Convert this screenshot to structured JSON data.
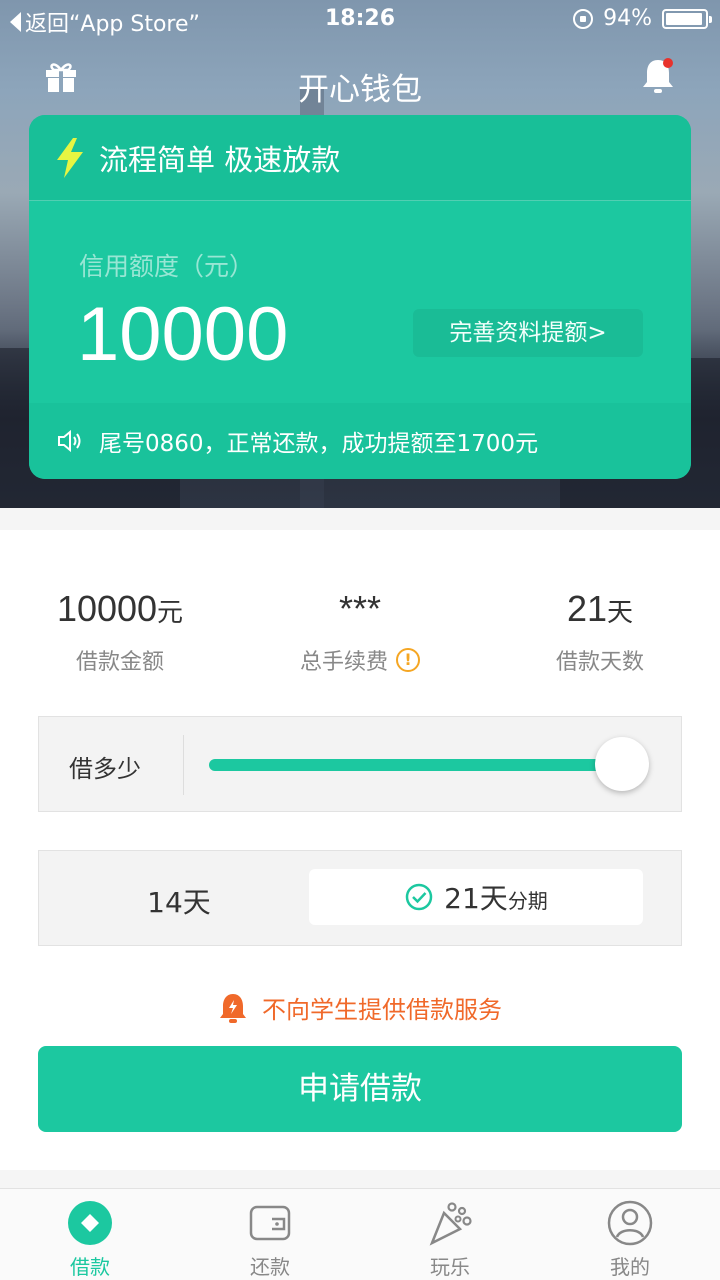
{
  "status_bar": {
    "back_label": "返回“App Store”",
    "time": "18:26",
    "battery": "94%",
    "battery_level": 0.94
  },
  "nav": {
    "title": "开心钱包",
    "left_icon": "gift-icon",
    "right_icon": "bell-icon",
    "has_unread": true
  },
  "card": {
    "headline": "流程简单 极速放款",
    "limit_label": "信用额度（元）",
    "limit_value": "10000",
    "improve_button": "完善资料提额>",
    "notice": "尾号0860，正常还款，成功提额至1700元"
  },
  "loan": {
    "amount_value": "10000",
    "amount_unit": "元",
    "amount_label": "借款金额",
    "fee_value": "***",
    "fee_label": "总手续费",
    "days_value": "21",
    "days_unit": "天",
    "days_label": "借款天数",
    "slider_label": "借多少",
    "slider_level": 1.0,
    "term_option_1": "14天",
    "term_option_2_main": "21天",
    "term_option_2_sub": "分期",
    "selected_term": "21天分期",
    "student_notice": "不向学生提供借款服务",
    "apply_button": "申请借款"
  },
  "tabbar": {
    "tabs": [
      {
        "label": "借款",
        "icon": "loan-icon",
        "active": true
      },
      {
        "label": "还款",
        "icon": "wallet-icon",
        "active": false
      },
      {
        "label": "玩乐",
        "icon": "party-icon",
        "active": false
      },
      {
        "label": "我的",
        "icon": "profile-icon",
        "active": false
      }
    ]
  },
  "colors": {
    "accent": "#1cc8a0",
    "warning": "#f0692a",
    "fee_info": "#f5a623"
  }
}
